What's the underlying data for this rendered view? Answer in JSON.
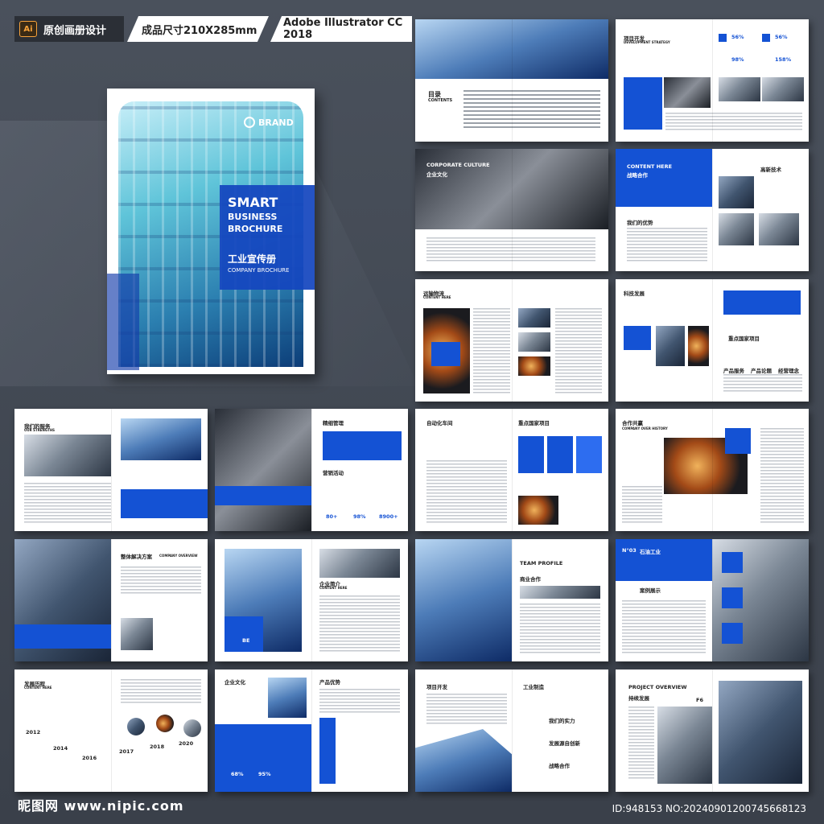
{
  "header": {
    "ai_badge": "Ai",
    "title": "原创画册设计",
    "size": "成品尺寸210X285mm",
    "software": "Adobe Illustrator CC 2018"
  },
  "cover": {
    "brand": "BRAND",
    "line1": "SMART",
    "line2": "BUSINESS",
    "line3": "BROCHURE",
    "cn_title": "工业宣传册",
    "en_sub": "COMPANY BROCHURE"
  },
  "spreads": {
    "s1": {
      "label": "目录",
      "sub": "CONTENTS"
    },
    "s2": {
      "label": "项目开发",
      "sub": "DEVELOPMENT STRATEGY",
      "p1": "56%",
      "p2": "56%",
      "p3": "98%",
      "p4": "158%"
    },
    "s3": {
      "label": "CORPORATE CULTURE",
      "sub": "企业文化"
    },
    "s4": {
      "label": "CONTENT HERE",
      "sub": "战略合作",
      "r1": "我们的优势",
      "r2": "高新技术"
    },
    "s5": {
      "label": "运输物流",
      "sub": "CONTENT HERE"
    },
    "s6": {
      "label": "科技发展",
      "sub": "重点国家项目",
      "r1": "产品服务",
      "r2": "产品论题",
      "r3": "经营理念"
    },
    "s7": {
      "label": "我们的服务",
      "sub": "OUR STRENGTHS"
    },
    "s8": {
      "label": "精细管理",
      "sub": "营销活动",
      "r1": "80+",
      "r2": "98%",
      "r3": "8900+"
    },
    "s9": {
      "label": "自动化车间",
      "sub": "重点国家项目"
    },
    "s10": {
      "label": "合作共赢",
      "sub": "COMPANY OVER HISTORY"
    },
    "s11": {
      "label": "整体解决方案",
      "sub": "COMPANY OVERVIEW"
    },
    "s12": {
      "label": "企业简介",
      "sub": "CONTENT HERE",
      "r1": "BE"
    },
    "s13": {
      "label": "TEAM PROFILE",
      "sub": "商业合作"
    },
    "s14": {
      "label": "石油工业",
      "sub": "案例展示",
      "r1": "N°03"
    },
    "s15": {
      "label": "发展历程",
      "sub": "CONTENT HERE",
      "y1": "2012",
      "y2": "2014",
      "y3": "2016",
      "y4": "2017",
      "y5": "2018",
      "y6": "2020"
    },
    "s16": {
      "label": "企业文化",
      "sub": "产品优势",
      "r1": "68%",
      "r2": "95%"
    },
    "s17": {
      "label": "项目开发",
      "sub": "工业制造",
      "r1": "我们的实力",
      "r2": "发展源自创新",
      "r3": "战略合作"
    },
    "s18": {
      "label": "PROJECT OVERVIEW",
      "sub": "持续发展",
      "r1": "F6"
    }
  },
  "footer": {
    "logo": "昵图网 www.nipic.com",
    "id": "ID:948153 NO:20240901200745668123"
  }
}
